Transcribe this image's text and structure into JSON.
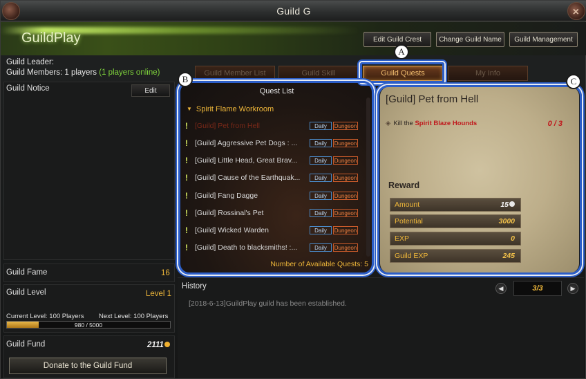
{
  "window": {
    "title": "Guild G"
  },
  "banner": {
    "guild_name": "GuildPlay"
  },
  "top_buttons": {
    "edit_crest": "Edit Guild Crest",
    "change_name": "Change Guild Name",
    "management": "Guild Management"
  },
  "info": {
    "leader_label": "Guild Leader:",
    "members_text": "Guild Members: 1 players",
    "online_text": "(1 players online)"
  },
  "notice": {
    "label": "Guild Notice",
    "edit_label": "Edit"
  },
  "fame": {
    "label": "Guild Fame",
    "value": "16"
  },
  "level": {
    "label": "Guild Level",
    "value": "Level 1",
    "current_text": "Current Level: 100 Players",
    "next_text": "Next Level: 100 Players",
    "progress_text": "980 / 5000",
    "progress_fraction": 0.196
  },
  "fund": {
    "label": "Guild Fund",
    "value": "2111",
    "donate_label": "Donate to the Guild Fund"
  },
  "tabs": [
    {
      "label": "Guild Member List",
      "active": false
    },
    {
      "label": "Guild Skill",
      "active": false
    },
    {
      "label": "Guild Quests",
      "active": true
    },
    {
      "label": "My Info",
      "active": false
    }
  ],
  "callouts": {
    "a": "A",
    "b": "B",
    "c": "C"
  },
  "quest_list": {
    "title": "Quest List",
    "group": "Spirit Flame Workroom",
    "badge_daily": "Daily",
    "badge_dungeon": "Dungeon",
    "items": [
      {
        "title": "[Guild] Pet from Hell",
        "selected": true
      },
      {
        "title": "[Guild] Aggressive Pet Dogs : ...",
        "selected": false
      },
      {
        "title": "[Guild] Little Head, Great Brav...",
        "selected": false
      },
      {
        "title": "[Guild] Cause of the Earthquak...",
        "selected": false
      },
      {
        "title": "[Guild] Fang Dagge",
        "selected": false
      },
      {
        "title": "[Guild] Rossinal's Pet",
        "selected": false
      },
      {
        "title": "[Guild] Wicked Warden",
        "selected": false
      },
      {
        "title": "[Guild] Death to blacksmiths! :...",
        "selected": false
      }
    ],
    "available_text": "Number of Available Quests: 5"
  },
  "quest_detail": {
    "title": "[Guild] Pet from Hell",
    "objective_prefix": "Kill the",
    "objective_target": "Spirit Blaze Hounds",
    "objective_count": "0 / 3",
    "reward_label": "Reward",
    "rewards": [
      {
        "label": "Amount",
        "value": "15"
      },
      {
        "label": "Potential",
        "value": "3000"
      },
      {
        "label": "EXP",
        "value": "0"
      },
      {
        "label": "Guild EXP",
        "value": "245"
      }
    ]
  },
  "history": {
    "label": "History",
    "entries": [
      "[2018-6-13]GuildPlay guild has been established."
    ],
    "page": "3/3"
  },
  "colors": {
    "accent": "#f0b83a",
    "online": "#7fd43c",
    "callout": "#2c5ec8"
  }
}
